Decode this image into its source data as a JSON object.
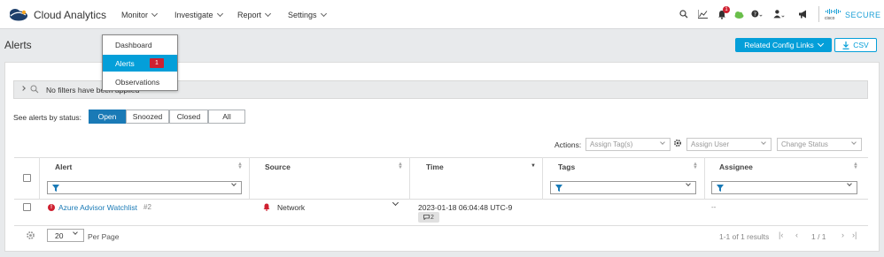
{
  "app": {
    "brand": "Cloud Analytics"
  },
  "nav": [
    {
      "label": "Monitor"
    },
    {
      "label": "Investigate"
    },
    {
      "label": "Report"
    },
    {
      "label": "Settings"
    }
  ],
  "header_icons": {
    "notification_count": "1",
    "cisco_wordmark": "cisco",
    "secure_label": "SECURE"
  },
  "monitor_menu": {
    "items": [
      {
        "label": "Dashboard"
      },
      {
        "label": "Alerts",
        "badge": "1"
      },
      {
        "label": "Observations"
      }
    ]
  },
  "page": {
    "title": "Alerts",
    "related_button": "Related Config Links",
    "csv_button": "CSV"
  },
  "filters": {
    "summary": "No filters have been applied"
  },
  "status_filter": {
    "label": "See alerts by status:",
    "options": [
      "Open",
      "Snoozed",
      "Closed",
      "All"
    ],
    "selected": "Open"
  },
  "actions": {
    "label": "Actions:",
    "assign_tags_placeholder": "Assign Tag(s)",
    "assign_user_placeholder": "Assign User",
    "change_status_placeholder": "Change Status"
  },
  "table": {
    "columns": [
      "Alert",
      "Source",
      "Time",
      "Tags",
      "Assignee"
    ],
    "rows": [
      {
        "alert": "Azure Advisor Watchlist",
        "alert_id": "#2",
        "source": "Network",
        "time": "2023-01-18 06:04:48 UTC-9",
        "comments": "2",
        "tags": "",
        "assignee": "--"
      }
    ]
  },
  "pagination": {
    "per_page_value": "20",
    "per_page_label": "Per Page",
    "results": "1-1 of 1 results",
    "pages": "1 / 1"
  },
  "colors": {
    "accent": "#049fd9",
    "segment_active": "#1a7ab6",
    "danger": "#cf2030",
    "cloud_ok": "#6abf4b"
  }
}
